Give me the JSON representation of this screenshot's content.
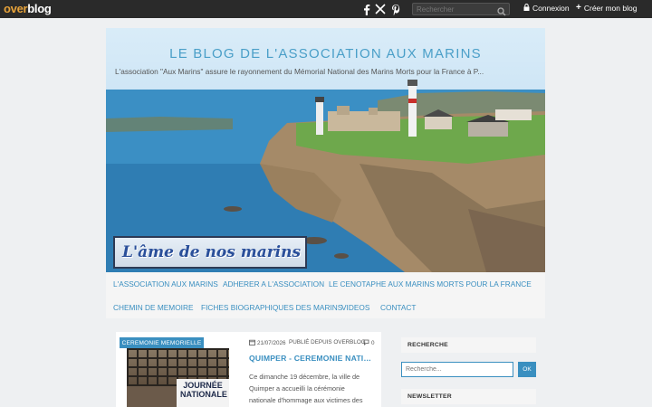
{
  "topbar": {
    "logo_o": "over",
    "logo_b": "blog",
    "search_placeholder": "Rechercher",
    "login_label": "Connexion",
    "create_label": "Créer mon blog"
  },
  "header": {
    "title": "LE BLOG DE L'ASSOCIATION AUX MARINS",
    "subtitle": "L'association \"Aux Marins\" assure le rayonnement du Mémorial National des Marins Morts pour la France à P...",
    "banner_text": "L'âme de nos marins"
  },
  "nav": {
    "items": [
      "L'ASSOCIATION AUX MARINS",
      "ADHERER A L'ASSOCIATION",
      "LE CENOTAPHE AUX MARINS MORTS POUR LA FRANCE",
      "CHEMIN DE MEMOIRE",
      "FICHES BIOGRAPHIQUES DES MARINS",
      "VIDEOS",
      "CONTACT"
    ]
  },
  "post": {
    "category": "CEREMONIE MEMORIELLE",
    "date": "21/07/2026",
    "published": "PUBLIÉ DEPUIS OVERBLOG",
    "comments": "0",
    "title": "QUIMPER - CEREMONIE NATION...",
    "excerpt": "Ce dimanche 19 décembre, la ville de Quimper a accueilli la cérémonie nationale d'hommage aux victimes des",
    "image_line1": "JOURNÉE",
    "image_line2": "NATIONALE"
  },
  "sidebar": {
    "search_title": "RECHERCHE",
    "search_placeholder": "Recherche...",
    "search_button": "OK",
    "newsletter_title": "NEWSLETTER"
  },
  "colors": {
    "accent": "#3a8fc0",
    "topbar": "#2a2a2a",
    "logo_accent": "#e8a33a"
  }
}
